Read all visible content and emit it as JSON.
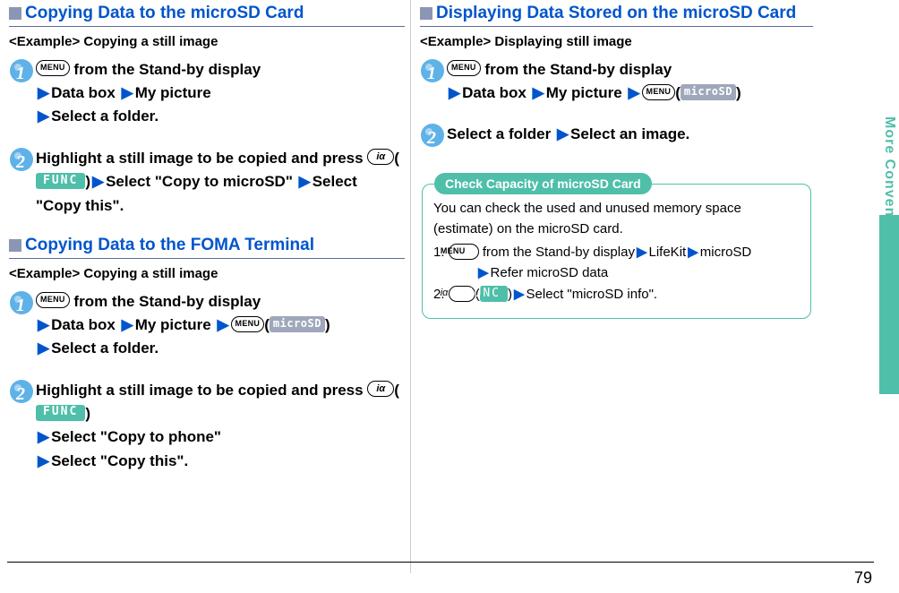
{
  "left": {
    "section1": "Copying Data to the microSD Card",
    "example1": "<Example> Copying a still image",
    "s1_step1_a": " from the Stand-by display",
    "s1_step1_b": "Data box",
    "s1_step1_c": "My picture",
    "s1_step1_d": "Select a folder.",
    "s1_step2_a": "Highlight a still image to be copied and press ",
    "s1_step2_b": "Select \"Copy to microSD\" ",
    "s1_step2_c": "Select \"Copy this\".",
    "section2": "Copying Data to the FOMA Terminal",
    "example2": "<Example> Copying a still image",
    "s2_step1_a": " from the Stand-by display",
    "s2_step1_b": "Data box",
    "s2_step1_c": "My picture",
    "s2_step1_d": "Select a folder.",
    "s2_step2_a": "Highlight a still image to be copied and press ",
    "s2_step2_b": "Select \"Copy to phone\"",
    "s2_step2_c": "Select \"Copy this\"."
  },
  "right": {
    "section1": "Displaying Data Stored on the microSD Card",
    "example1": "<Example> Displaying still image",
    "s1_step1_a": " from the Stand-by display",
    "s1_step1_b": "Data box",
    "s1_step1_c": "My picture",
    "s1_step2_a": "Select a folder",
    "s1_step2_b": "Select an image.",
    "callout_title": "Check Capacity of microSD Card",
    "callout_body": "You can check the used and unused memory space (estimate) on the microSD card.",
    "callout_li1_a": "1. ",
    "callout_li1_b": " from the Stand-by display",
    "callout_li1_c": "LifeKit",
    "callout_li1_d": "microSD",
    "callout_li1_e": "Refer microSD data",
    "callout_li2_a": "2. ",
    "callout_li2_b": "Select \"microSD info\"."
  },
  "keys": {
    "menu": "MENU",
    "func": "FUNC",
    "microsd": "microSD",
    "i": "iα"
  },
  "side_tab": "More Convenient",
  "page_number": "79"
}
